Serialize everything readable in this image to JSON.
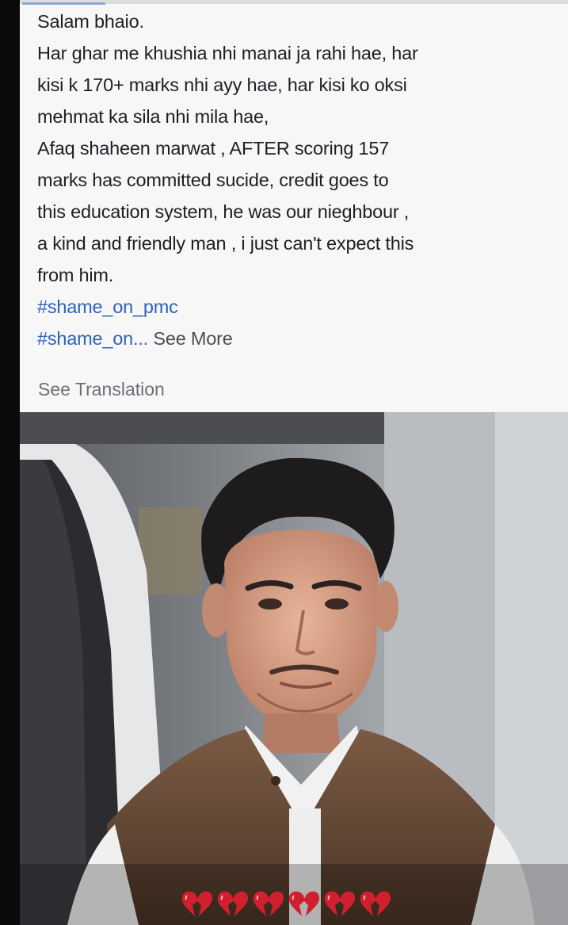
{
  "post": {
    "greeting": "Salam bhaio.",
    "lines": [
      "Har ghar me khushia nhi manai ja rahi hae, har",
      "kisi k 170+ marks nhi ayy hae, har kisi ko oksi",
      "mehmat ka sila nhi mila hae,",
      "Afaq shaheen marwat , AFTER scoring 157",
      "marks has committed sucide, credit goes to",
      "this education system, he was our nieghbour ,",
      "a kind and friendly man , i just can't expect this",
      "from him."
    ],
    "hashtag_1": "#shame_on_pmc",
    "hashtag_2_truncated": "#shame_on...",
    "see_more": "See More",
    "see_translation": "See Translation"
  },
  "photo": {
    "overlay_emoji": "broken-heart-icon",
    "emoji_count": 6,
    "emoji_color": "#d0202f"
  },
  "colors": {
    "hashtag": "#2d63b8",
    "text": "#1d1f23",
    "muted": "#6c7075",
    "card_bg": "#f7f7f8"
  }
}
